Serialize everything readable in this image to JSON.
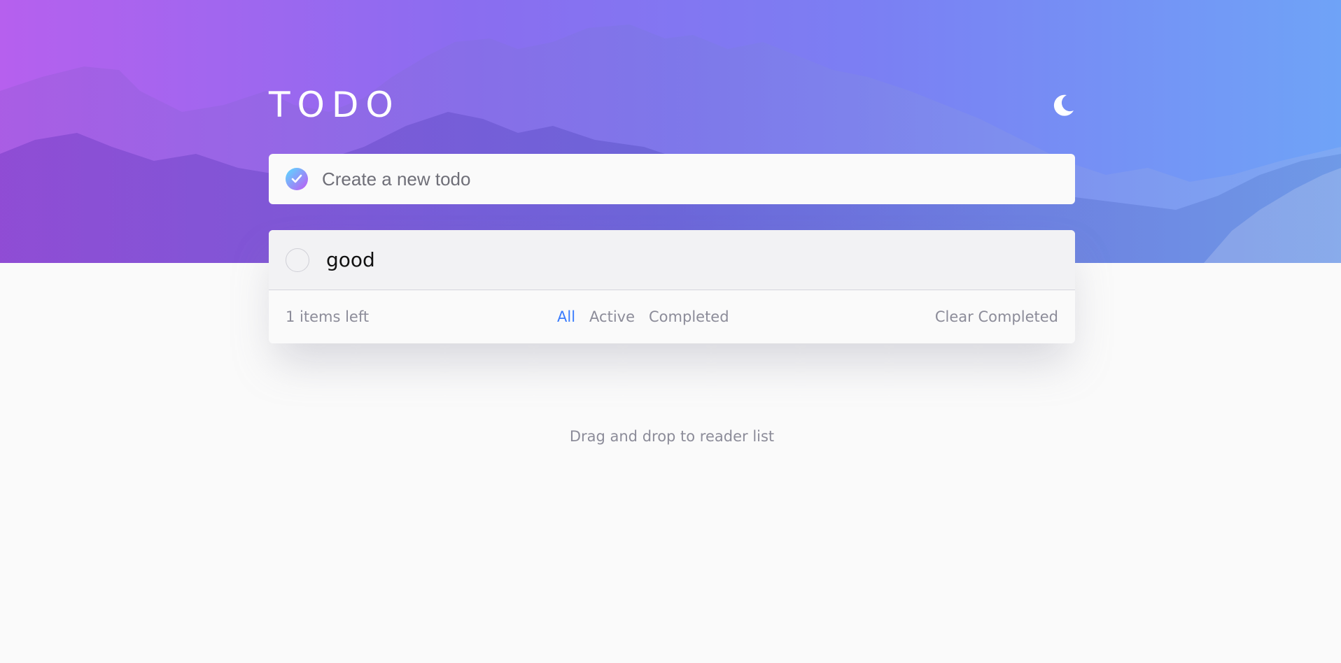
{
  "header": {
    "title": "TODO",
    "theme_toggle_icon": "moon-icon"
  },
  "new_todo": {
    "placeholder": "Create a new todo",
    "value": "",
    "icon": "check-icon",
    "accent_gradient": [
      "#57ddff",
      "#c058f3"
    ]
  },
  "todos": [
    {
      "text": "good",
      "completed": false
    }
  ],
  "footer": {
    "items_left": "1 items left",
    "filters": [
      {
        "label": "All",
        "active": true
      },
      {
        "label": "Active",
        "active": false
      },
      {
        "label": "Completed",
        "active": false
      }
    ],
    "clear_label": "Clear Completed"
  },
  "hint": "Drag and drop to reader list",
  "colors": {
    "active_filter": "#3a7cfd",
    "muted_text": "#8c8c99",
    "background": "#fafafa"
  }
}
